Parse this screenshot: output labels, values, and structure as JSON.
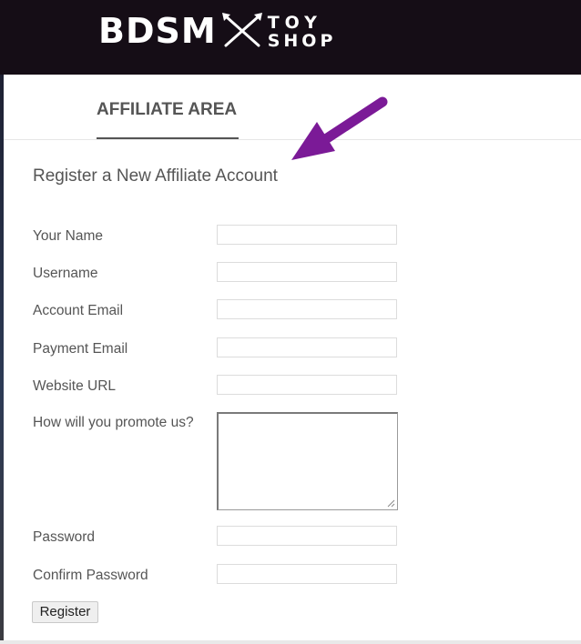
{
  "header": {
    "logo_main": "BDSM",
    "logo_sub_line1": "TOY",
    "logo_sub_line2": "SHOP",
    "background_color": "#150d16"
  },
  "tab": {
    "title": "AFFILIATE AREA"
  },
  "annotation": {
    "arrow_color": "#7b1a97",
    "icon": "arrow-pointer-icon"
  },
  "form": {
    "heading": "Register a New Affiliate Account",
    "fields": [
      {
        "label": "Your Name",
        "value": ""
      },
      {
        "label": "Username",
        "value": ""
      },
      {
        "label": "Account Email",
        "value": ""
      },
      {
        "label": "Payment Email",
        "value": ""
      },
      {
        "label": "Website URL",
        "value": ""
      },
      {
        "label": "How will you promote us?",
        "value": ""
      },
      {
        "label": "Password",
        "value": ""
      },
      {
        "label": "Confirm Password",
        "value": ""
      }
    ],
    "submit_label": "Register"
  }
}
